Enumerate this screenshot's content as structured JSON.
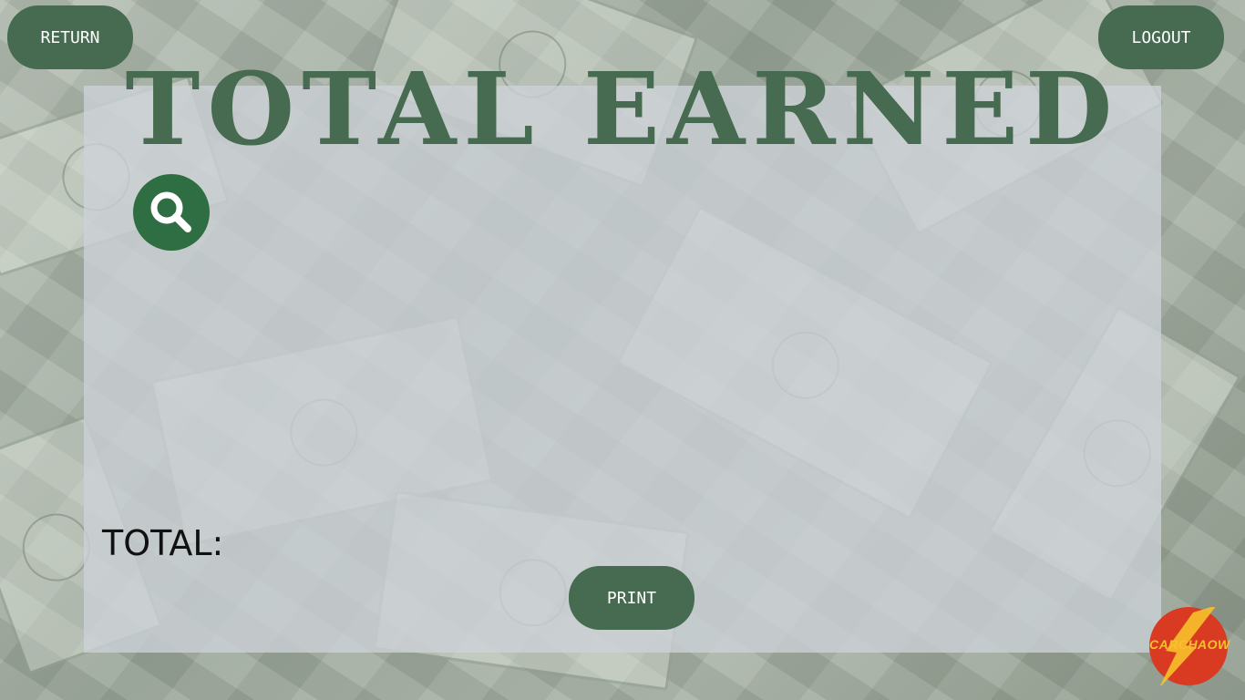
{
  "nav": {
    "return_label": "RETURN",
    "logout_label": "LOGOUT"
  },
  "page": {
    "title": "TOTAL EARNED",
    "total_label": "TOTAL:",
    "total_value": ""
  },
  "actions": {
    "print_label": "PRINT",
    "search_icon": "search-icon"
  },
  "brand": {
    "logo_text": "CARCHAOW"
  },
  "colors": {
    "accent": "#476b50",
    "search_button": "#2f6e43",
    "logo_red": "#d93a22",
    "logo_yellow": "#f7c12b"
  }
}
